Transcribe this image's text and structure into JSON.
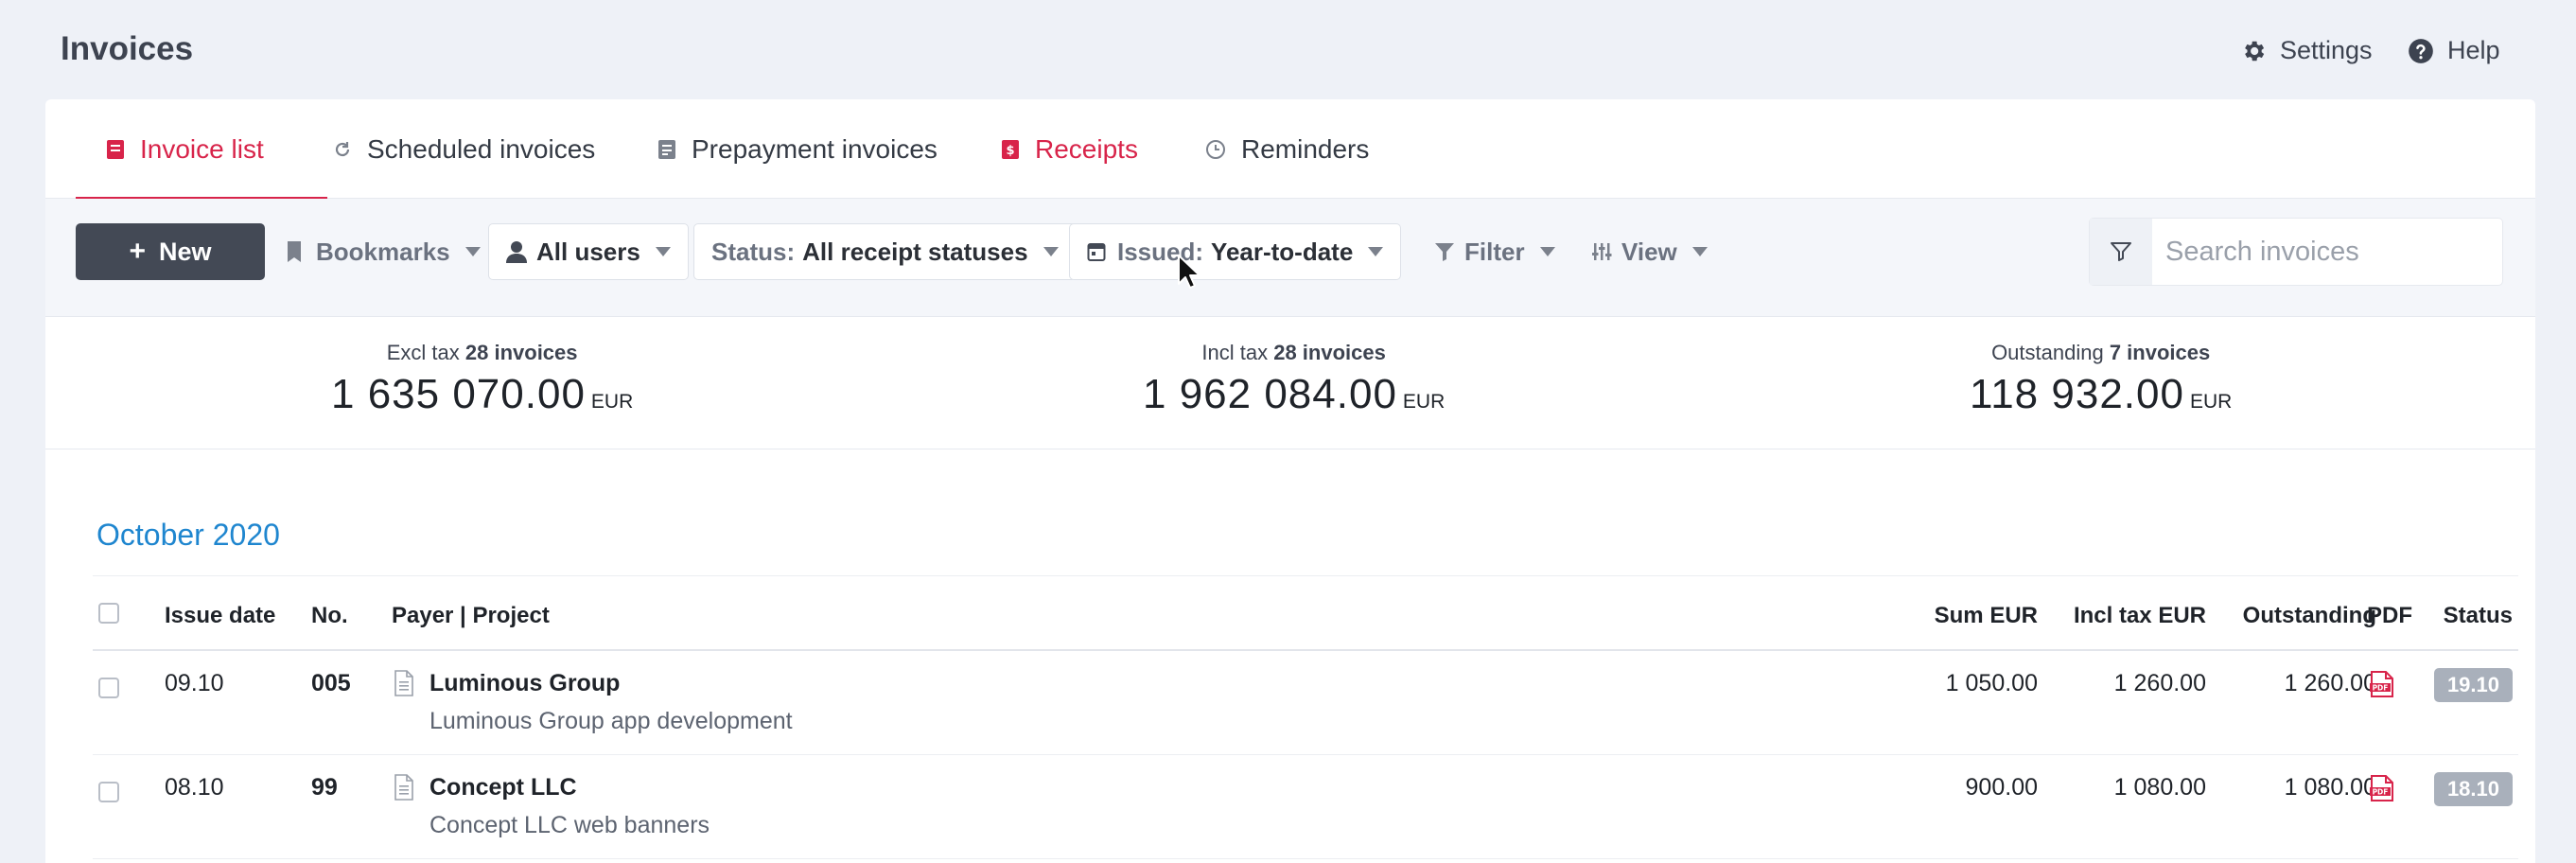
{
  "app": {
    "title": "Invoices"
  },
  "topbar": {
    "settings_label": "Settings",
    "help_label": "Help"
  },
  "tabs": [
    {
      "label": "Invoice list",
      "icon": "invoice-icon",
      "active": true
    },
    {
      "label": "Scheduled invoices",
      "icon": "refresh-icon"
    },
    {
      "label": "Prepayment invoices",
      "icon": "document-icon"
    },
    {
      "label": "Receipts",
      "icon": "receipt-icon"
    },
    {
      "label": "Reminders",
      "icon": "clock-icon"
    }
  ],
  "toolbar": {
    "new_label": "New",
    "bookmarks_label": "Bookmarks",
    "users_label": "All users",
    "status_prefix": "Status:",
    "status_value": "All receipt statuses",
    "issued_prefix": "Issued:",
    "issued_value": "Year-to-date",
    "filter_label": "Filter",
    "view_label": "View",
    "search_placeholder": "Search invoices"
  },
  "summary": [
    {
      "label": "Excl tax",
      "count": "28 invoices",
      "value": "1 635 070.00",
      "currency": "EUR"
    },
    {
      "label": "Incl tax",
      "count": "28 invoices",
      "value": "1 962 084.00",
      "currency": "EUR"
    },
    {
      "label": "Outstanding",
      "count": "7 invoices",
      "value": "118 932.00",
      "currency": "EUR"
    }
  ],
  "month": "October 2020",
  "table": {
    "headers": {
      "issue_date": "Issue date",
      "no": "No.",
      "payer": "Payer | Project",
      "sum": "Sum EUR",
      "incl_tax": "Incl tax EUR",
      "outstanding": "Outstanding",
      "pdf": "PDF",
      "status": "Status"
    },
    "rows": [
      {
        "date": "09.10",
        "no": "005",
        "payer": "Luminous Group",
        "project": "Luminous Group app development",
        "sum": "1 050.00",
        "incl_tax": "1 260.00",
        "outstanding": "1 260.00",
        "status": "19.10"
      },
      {
        "date": "08.10",
        "no": "99",
        "payer": "Concept LLC",
        "project": "Concept LLC web banners",
        "sum": "900.00",
        "incl_tax": "1 080.00",
        "outstanding": "1 080.00",
        "status": "18.10"
      }
    ]
  },
  "colors": {
    "accent": "#d8244a",
    "link": "#1f86cf",
    "button": "#434955",
    "badge": "#a9b0bb"
  }
}
